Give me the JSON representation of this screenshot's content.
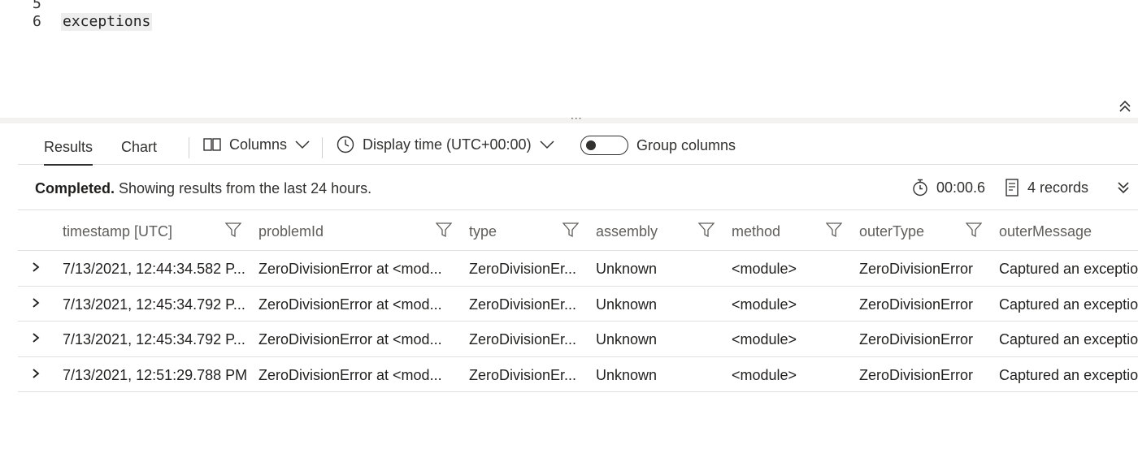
{
  "editor": {
    "lines": [
      {
        "number": "5",
        "text": ""
      },
      {
        "number": "6",
        "text": "exceptions"
      }
    ]
  },
  "toolbar": {
    "tabs": [
      {
        "label": "Results",
        "active": true
      },
      {
        "label": "Chart",
        "active": false
      }
    ],
    "columns_label": "Columns",
    "display_time_label": "Display time (UTC+00:00)",
    "group_columns_label": "Group columns",
    "group_columns_on": false
  },
  "status": {
    "state": "Completed.",
    "message": " Showing results from the last 24 hours.",
    "duration": "00:00.6",
    "records": "4 records"
  },
  "grid": {
    "columns": [
      "timestamp [UTC]",
      "problemId",
      "type",
      "assembly",
      "method",
      "outerType",
      "outerMessage"
    ],
    "rows": [
      [
        "7/13/2021, 12:44:34.582 P...",
        "ZeroDivisionError at <mod...",
        "ZeroDivisionEr...",
        "Unknown",
        "<module>",
        "ZeroDivisionError",
        "Captured an exception"
      ],
      [
        "7/13/2021, 12:45:34.792 P...",
        "ZeroDivisionError at <mod...",
        "ZeroDivisionEr...",
        "Unknown",
        "<module>",
        "ZeroDivisionError",
        "Captured an exception"
      ],
      [
        "7/13/2021, 12:45:34.792 P...",
        "ZeroDivisionError at <mod...",
        "ZeroDivisionEr...",
        "Unknown",
        "<module>",
        "ZeroDivisionError",
        "Captured an exception"
      ],
      [
        "7/13/2021, 12:51:29.788 PM",
        "ZeroDivisionError at <mod...",
        "ZeroDivisionEr...",
        "Unknown",
        "<module>",
        "ZeroDivisionError",
        "Captured an exception"
      ]
    ]
  },
  "icons": {
    "collapse": "double-chevron-up-icon",
    "columns": "columns-icon",
    "display_time": "clock-icon",
    "duration": "stopwatch-icon",
    "records": "document-icon",
    "expand_all": "double-chevron-down-icon",
    "filter": "filter-icon",
    "row_expand": "chevron-right-icon"
  }
}
